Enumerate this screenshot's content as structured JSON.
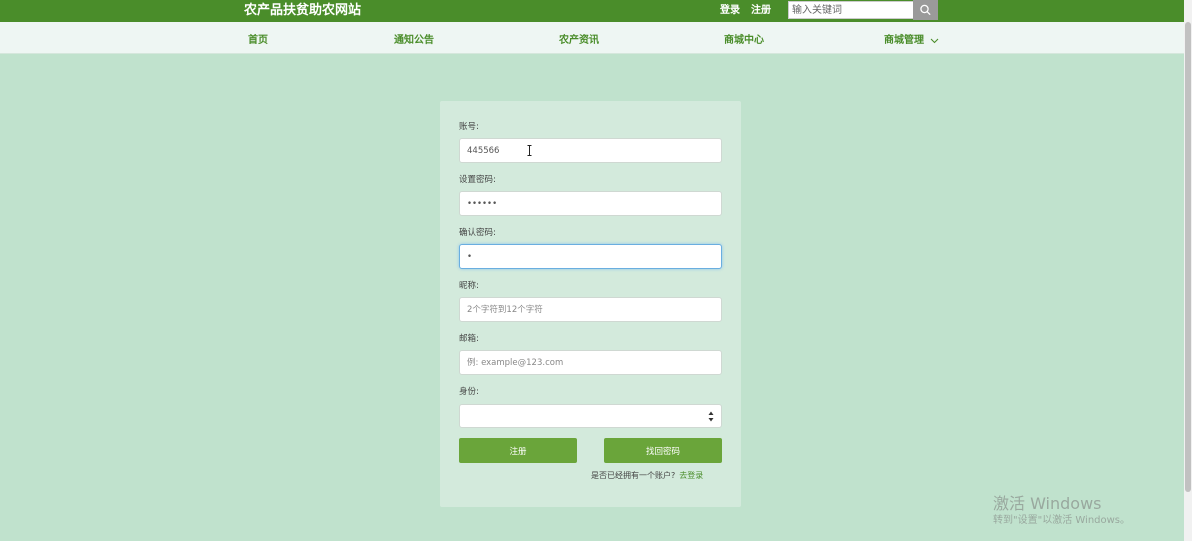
{
  "header": {
    "site_title": "农产品扶贫助农网站",
    "login_label": "登录",
    "register_label": "注册",
    "search_placeholder": "输入关键词",
    "search_icon": "search-icon"
  },
  "nav": {
    "items": [
      {
        "label": "首页"
      },
      {
        "label": "通知公告"
      },
      {
        "label": "农产资讯"
      },
      {
        "label": "商城中心"
      },
      {
        "label": "商城管理"
      }
    ],
    "dropdown_icon": "chevron-down-icon"
  },
  "form": {
    "account": {
      "label": "账号:",
      "value": "445566",
      "placeholder": ""
    },
    "password": {
      "label": "设置密码:",
      "value": "••••••",
      "placeholder": ""
    },
    "confirm_password": {
      "label": "确认密码:",
      "value": "•",
      "placeholder": ""
    },
    "nickname": {
      "label": "昵称:",
      "value": "",
      "placeholder": "2个字符到12个字符"
    },
    "email": {
      "label": "邮箱:",
      "value": "",
      "placeholder": "例: example@123.com"
    },
    "role": {
      "label": "身份:",
      "selected": ""
    },
    "register_button": "注册",
    "recover_button": "找回密码",
    "login_prompt": "是否已经拥有一个账户?",
    "login_link": "去登录"
  },
  "watermark": {
    "line1": "激活 Windows",
    "line2": "转到\"设置\"以激活 Windows。"
  },
  "colors": {
    "topbar": "#4a8d2a",
    "accent_green": "#6aa53a",
    "page_background": "#c0e2cd",
    "panel_background": "#d3eadc"
  }
}
